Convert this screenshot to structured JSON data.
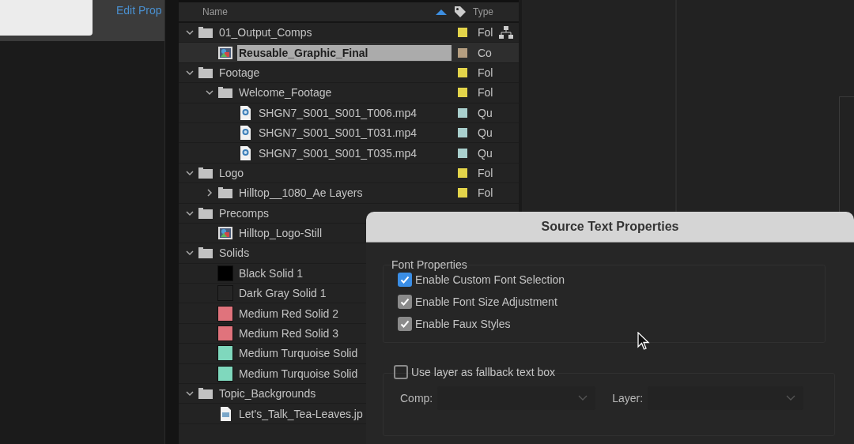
{
  "left_panel": {
    "edit_link": "Edit Prop"
  },
  "project": {
    "columns": {
      "name": "Name",
      "type": "Type"
    },
    "items": [
      {
        "kind": "folder",
        "name": "01_Output_Comps",
        "expanded": true,
        "selected": false,
        "color": "#e3d44a",
        "type": "Fol",
        "children": [
          {
            "kind": "comp",
            "name": "Reusable_Graphic_Final",
            "selected": true,
            "color": "#b59e80",
            "type": "Co"
          }
        ]
      },
      {
        "kind": "folder",
        "name": "Footage",
        "expanded": true,
        "selected": false,
        "color": "#e3d44a",
        "type": "Fol",
        "children": [
          {
            "kind": "folder",
            "name": "Welcome_Footage",
            "expanded": true,
            "selected": false,
            "color": "#e3d44a",
            "type": "Fol",
            "children": [
              {
                "kind": "video",
                "name": "SHGN7_S001_S001_T006.mp4",
                "selected": false,
                "color": "#a9cfcd",
                "type": "Qu"
              },
              {
                "kind": "video",
                "name": "SHGN7_S001_S001_T031.mp4",
                "selected": false,
                "color": "#a9cfcd",
                "type": "Qu"
              },
              {
                "kind": "video",
                "name": "SHGN7_S001_S001_T035.mp4",
                "selected": false,
                "color": "#a9cfcd",
                "type": "Qu"
              }
            ]
          }
        ]
      },
      {
        "kind": "folder",
        "name": "Logo",
        "expanded": true,
        "selected": false,
        "color": "#e3d44a",
        "type": "Fol",
        "children": [
          {
            "kind": "folder",
            "name": "Hilltop__1080_Ae Layers",
            "expanded": false,
            "selected": false,
            "color": "#e3d44a",
            "type": "Fol"
          }
        ]
      },
      {
        "kind": "folder",
        "name": "Precomps",
        "expanded": true,
        "selected": false,
        "children": [
          {
            "kind": "comp",
            "name": "Hilltop_Logo-Still",
            "selected": false
          }
        ]
      },
      {
        "kind": "folder",
        "name": "Solids",
        "expanded": true,
        "selected": false,
        "children": [
          {
            "kind": "solid",
            "name": "Black Solid 1",
            "selected": false,
            "color": "#000000"
          },
          {
            "kind": "solid",
            "name": "Dark Gray Solid 1",
            "selected": false,
            "color": "#262626"
          },
          {
            "kind": "solid",
            "name": "Medium Red Solid 2",
            "selected": false,
            "color": "#e0737c"
          },
          {
            "kind": "solid",
            "name": "Medium Red Solid 3",
            "selected": false,
            "color": "#e0737c"
          },
          {
            "kind": "solid",
            "name": "Medium Turquoise Solid",
            "selected": false,
            "color": "#7fd8bd"
          },
          {
            "kind": "solid",
            "name": "Medium Turquoise Solid",
            "selected": false,
            "color": "#7fd8bd"
          }
        ]
      },
      {
        "kind": "folder",
        "name": "Topic_Backgrounds",
        "expanded": true,
        "selected": false,
        "children": [
          {
            "kind": "image",
            "name": "Let's_Talk_Tea-Leaves.jp",
            "selected": false
          }
        ]
      }
    ]
  },
  "dialog": {
    "title": "Source Text Properties",
    "font_group": {
      "legend": "Font Properties",
      "options": [
        {
          "label": "Enable Custom Font Selection",
          "checked": true,
          "focused": true
        },
        {
          "label": "Enable Font Size Adjustment",
          "checked": true,
          "focused": false
        },
        {
          "label": "Enable Faux Styles",
          "checked": true,
          "focused": false
        }
      ]
    },
    "fallback": {
      "label": "Use layer as fallback text box",
      "checked": false,
      "fields": [
        {
          "label": "Comp:"
        },
        {
          "label": "Layer:"
        }
      ]
    }
  }
}
